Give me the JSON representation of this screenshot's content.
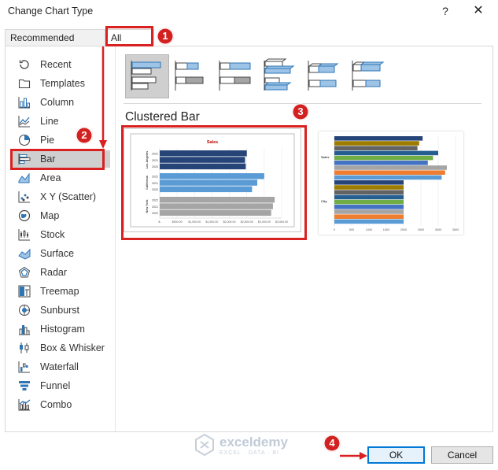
{
  "window": {
    "title": "Change Chart Type",
    "help_glyph": "?",
    "close_glyph": "✕"
  },
  "tabs": [
    {
      "label": "Recommended Charts"
    },
    {
      "label": "All Charts"
    }
  ],
  "chart_types": [
    {
      "label": "Recent",
      "icon": "recent-icon"
    },
    {
      "label": "Templates",
      "icon": "templates-icon"
    },
    {
      "label": "Column",
      "icon": "column-chart-icon"
    },
    {
      "label": "Line",
      "icon": "line-chart-icon"
    },
    {
      "label": "Pie",
      "icon": "pie-chart-icon"
    },
    {
      "label": "Bar",
      "icon": "bar-chart-icon",
      "selected": true
    },
    {
      "label": "Area",
      "icon": "area-chart-icon"
    },
    {
      "label": "X Y (Scatter)",
      "icon": "scatter-chart-icon"
    },
    {
      "label": "Map",
      "icon": "map-chart-icon"
    },
    {
      "label": "Stock",
      "icon": "stock-chart-icon"
    },
    {
      "label": "Surface",
      "icon": "surface-chart-icon"
    },
    {
      "label": "Radar",
      "icon": "radar-chart-icon"
    },
    {
      "label": "Treemap",
      "icon": "treemap-chart-icon"
    },
    {
      "label": "Sunburst",
      "icon": "sunburst-chart-icon"
    },
    {
      "label": "Histogram",
      "icon": "histogram-chart-icon"
    },
    {
      "label": "Box & Whisker",
      "icon": "box-whisker-chart-icon"
    },
    {
      "label": "Waterfall",
      "icon": "waterfall-chart-icon"
    },
    {
      "label": "Funnel",
      "icon": "funnel-chart-icon"
    },
    {
      "label": "Combo",
      "icon": "combo-chart-icon"
    }
  ],
  "subtypes": [
    {
      "icon": "clustered-bar-icon",
      "selected": true
    },
    {
      "icon": "stacked-bar-icon"
    },
    {
      "icon": "100-stacked-bar-icon"
    },
    {
      "icon": "3d-clustered-bar-icon"
    },
    {
      "icon": "3d-stacked-bar-icon"
    },
    {
      "icon": "3d-100-stacked-bar-icon"
    }
  ],
  "selected_subtype_title": "Clustered Bar",
  "buttons": {
    "ok": "OK",
    "cancel": "Cancel"
  },
  "badges": [
    "1",
    "2",
    "3",
    "4"
  ],
  "watermark": {
    "name": "exceldemy",
    "tagline": "EXCEL · DATA · BI"
  },
  "colors": {
    "highlight": "#d92121",
    "series_2022": "#264478",
    "series_2021": "#9e7c00",
    "series_2020": "#4472c4"
  },
  "chart_data": [
    {
      "type": "bar",
      "title": "Sales",
      "groups": [
        "Los Angeles",
        "California",
        "New York"
      ],
      "categories": [
        "2022",
        "2021",
        "2020"
      ],
      "series": [
        {
          "values": [
            2500,
            2450,
            2470
          ],
          "color": "#264478"
        },
        {
          "values": [
            3000,
            2800,
            2650
          ],
          "color": "#5b9bd5"
        },
        {
          "values": [
            3300,
            3250,
            3200
          ],
          "color": "#a5a5a5"
        }
      ],
      "xtick_labels": [
        "$-",
        "$500.00",
        "$1,000.00",
        "$1,500.00",
        "$2,000.00",
        "$2,500.00",
        "$3,000.00",
        "$3,500.00"
      ],
      "xlim": [
        0,
        3500
      ]
    },
    {
      "type": "bar",
      "categories": [
        "Sales",
        "City"
      ],
      "xtick_labels": [
        "0",
        "500",
        "1000",
        "1500",
        "2000",
        "2500",
        "3000",
        "3500"
      ],
      "xlim": [
        0,
        3500
      ],
      "bars": [
        {
          "group": "Sales",
          "value": 2550,
          "color": "#264478"
        },
        {
          "group": "Sales",
          "value": 2450,
          "color": "#9e7c00"
        },
        {
          "group": "Sales",
          "value": 2400,
          "color": "#636363"
        },
        {
          "group": "Sales",
          "value": 3000,
          "color": "#255e91"
        },
        {
          "group": "Sales",
          "value": 2850,
          "color": "#70ad47"
        },
        {
          "group": "Sales",
          "value": 2700,
          "color": "#4472c4"
        },
        {
          "group": "Sales",
          "value": 3250,
          "color": "#a5a5a5"
        },
        {
          "group": "Sales",
          "value": 3200,
          "color": "#ed7d31"
        },
        {
          "group": "Sales",
          "value": 3100,
          "color": "#5b9bd5"
        },
        {
          "group": "City",
          "value": 2000,
          "color": "#264478"
        },
        {
          "group": "City",
          "value": 2000,
          "color": "#9e7c00"
        },
        {
          "group": "City",
          "value": 2000,
          "color": "#636363"
        },
        {
          "group": "City",
          "value": 2000,
          "color": "#255e91"
        },
        {
          "group": "City",
          "value": 2000,
          "color": "#70ad47"
        },
        {
          "group": "City",
          "value": 2000,
          "color": "#4472c4"
        },
        {
          "group": "City",
          "value": 2000,
          "color": "#a5a5a5"
        },
        {
          "group": "City",
          "value": 2000,
          "color": "#ed7d31"
        },
        {
          "group": "City",
          "value": 2000,
          "color": "#5b9bd5"
        }
      ]
    }
  ]
}
